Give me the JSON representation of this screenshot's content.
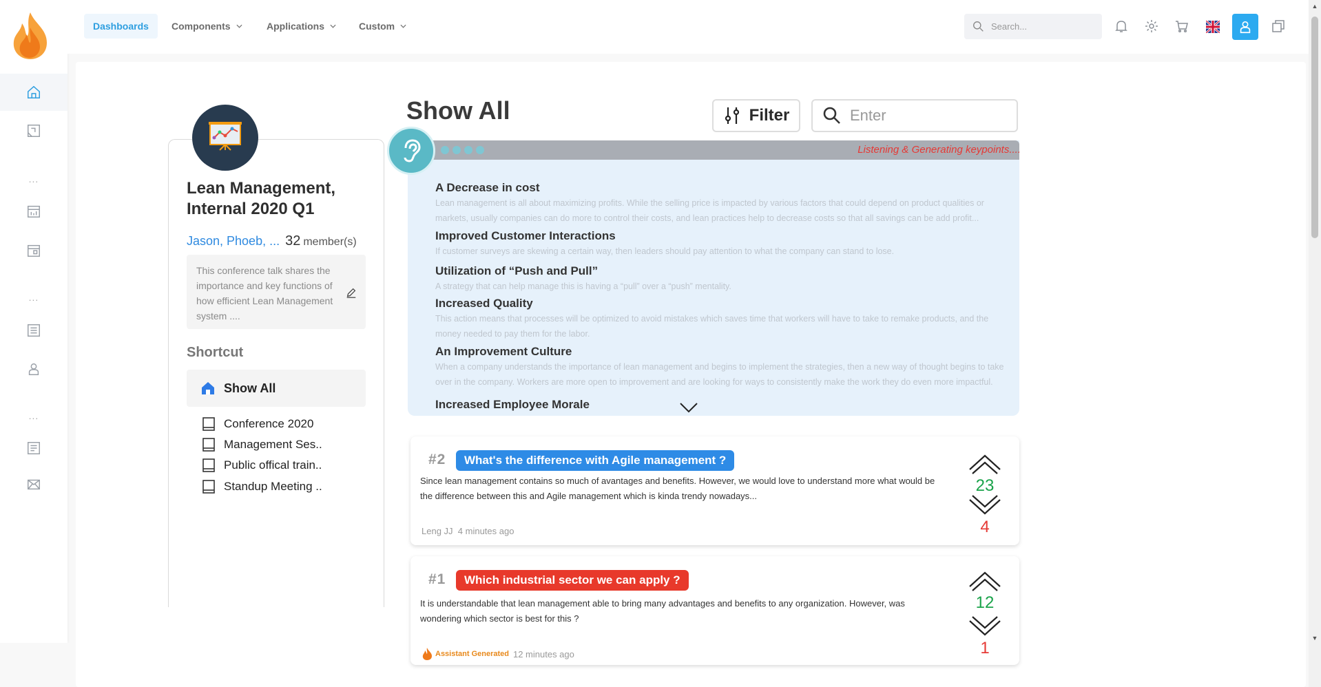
{
  "topbar": {
    "menus": [
      {
        "label": "Dashboards",
        "active": true
      },
      {
        "label": "Components",
        "active": false
      },
      {
        "label": "Applications",
        "active": false
      },
      {
        "label": "Custom",
        "active": false
      }
    ],
    "search_placeholder": "Search..."
  },
  "sidebar": {
    "dots": "..."
  },
  "conference": {
    "title": "Lean Management, Internal 2020 Q1",
    "members_names": "Jason, Phoeb, ...",
    "members_count": "32",
    "members_label": "member(s)",
    "description": "This conference talk shares the importance and key functions of how efficient Lean Management system ....",
    "shortcut_title": "Shortcut",
    "shortcut_show_all": "Show All",
    "shortcuts": [
      "Conference 2020",
      "Management Ses..",
      "Public offical train..",
      "Standup Meeting .."
    ]
  },
  "main": {
    "title": "Show All",
    "filter_label": "Filter",
    "enter_placeholder": "Enter",
    "listening_status": "Listening & Generating keypoints....",
    "keypoints": [
      {
        "title": "A Decrease in cost",
        "body": "Lean management is all about maximizing profits. While the selling price is impacted by various factors that could depend on product qualities or markets, usually companies can do more to control their costs, and lean practices help to decrease costs so that all savings can be add profit..."
      },
      {
        "title": "Improved Customer Interactions",
        "body": "If customer surveys are skewing a certain way, then leaders should pay attention to what the company can stand to lose."
      },
      {
        "title": "Utilization of “Push and Pull”",
        "body": "A strategy that can help manage this is having a “pull” over a “push” mentality."
      },
      {
        "title": "Increased Quality",
        "body": "This action means that processes will be optimized to avoid mistakes which saves time that workers will have to take to remake products, and the money needed to pay them for the labor."
      },
      {
        "title": "An Improvement Culture",
        "body": "When a company understands the importance of lean management and begins to implement the strategies, then a new way of thought begins to take over in the company. Workers are more open to improvement and are looking for ways to consistently make the work they do even more impactful."
      },
      {
        "title": "Increased Employee Morale",
        "body": ""
      }
    ],
    "questions": [
      {
        "number": "#2",
        "title": "What's the difference with Agile management ?",
        "badge_color": "#2e8be6",
        "text": "Since lean management contains so much of avantages and benefits. However, we would love to understand more what would be the difference between this and Agile management which is kinda trendy nowadays...",
        "author": "Leng JJ",
        "time": "4 minutes ago",
        "up": "23",
        "down": "4"
      },
      {
        "number": "#1",
        "title": "Which industrial sector we can apply ?",
        "badge_color": "#e8392b",
        "text": "It is understandable that lean management able to bring many advantages and benefits to any organization. However, was wondering which sector is best for this ?",
        "author": "Assistant Generated",
        "time": "12 minutes ago",
        "up": "12",
        "down": "1"
      }
    ]
  }
}
